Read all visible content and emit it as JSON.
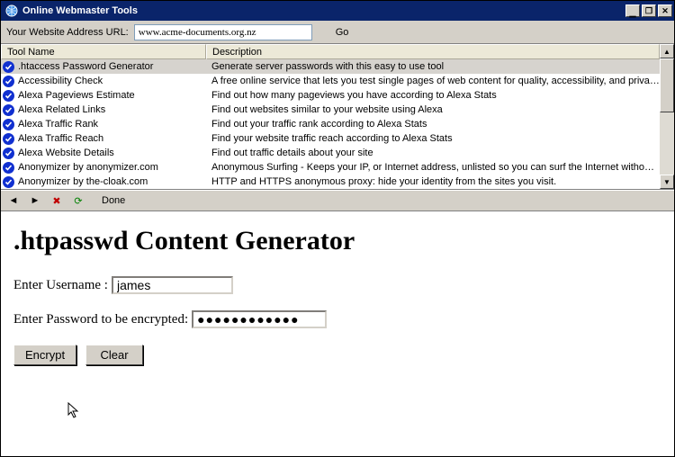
{
  "window": {
    "title": "Online Webmaster Tools"
  },
  "urlbar": {
    "label": "Your Website Address URL:",
    "value": "www.acme-documents.org.nz",
    "go": "Go"
  },
  "table": {
    "headers": {
      "name": "Tool Name",
      "desc": "Description"
    },
    "rows": [
      {
        "name": ".htaccess Password Generator",
        "desc": "Generate server passwords with this easy to use tool",
        "selected": true
      },
      {
        "name": "Accessibility Check",
        "desc": "A free online service that lets you test single pages of web content for quality, accessibility, and privac..."
      },
      {
        "name": "Alexa Pageviews Estimate",
        "desc": "Find out how many pageviews you have according to Alexa Stats"
      },
      {
        "name": "Alexa Related Links",
        "desc": "Find out websites similar to your website using Alexa"
      },
      {
        "name": "Alexa Traffic Rank",
        "desc": "Find out your traffic rank according to Alexa Stats"
      },
      {
        "name": "Alexa Traffic Reach",
        "desc": "Find your website traffic reach according to Alexa Stats"
      },
      {
        "name": "Alexa Website Details",
        "desc": "Find out traffic details about your site"
      },
      {
        "name": "Anonymizer by anonymizer.com",
        "desc": "Anonymous Surfing - Keeps your IP, or Internet address, unlisted so you can surf the Internet without ..."
      },
      {
        "name": "Anonymizer by the-cloak.com",
        "desc": "HTTP and HTTPS anonymous proxy: hide your identity from the sites you visit."
      }
    ]
  },
  "nav": {
    "status": "Done"
  },
  "content": {
    "heading": ".htpasswd Content Generator",
    "user_label": "Enter Username :",
    "user_value": "james",
    "pass_label": "Enter Password to be encrypted:",
    "pass_value": "●●●●●●●●●●●●",
    "encrypt": "Encrypt",
    "clear": "Clear"
  }
}
